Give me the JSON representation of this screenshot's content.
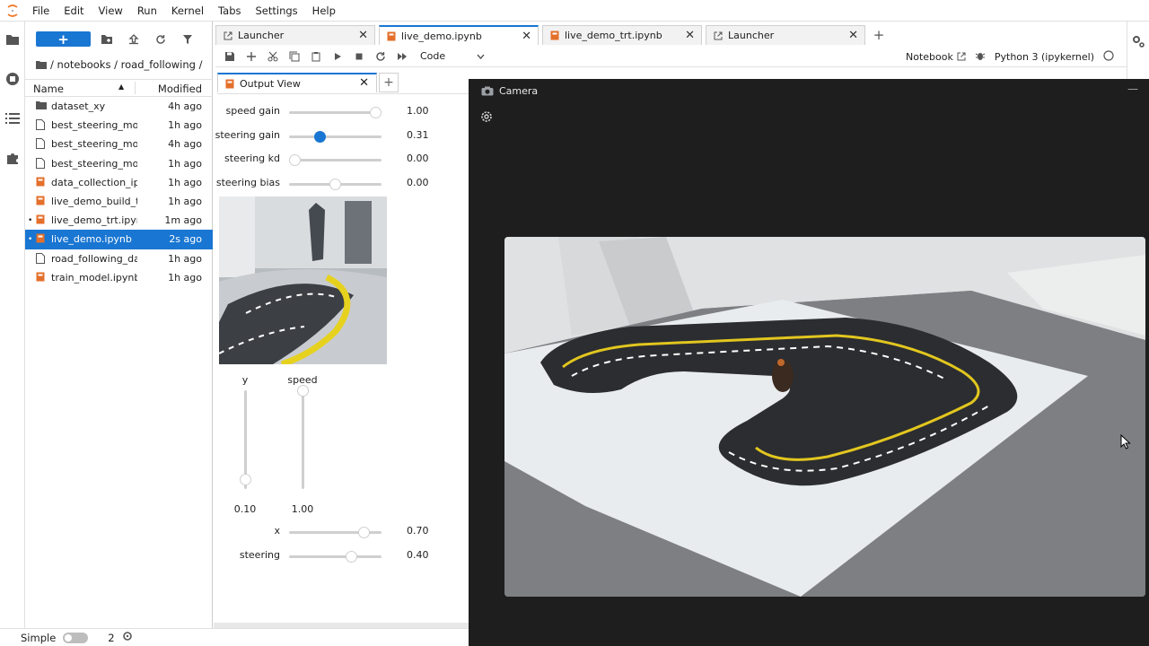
{
  "menu": [
    "File",
    "Edit",
    "View",
    "Run",
    "Kernel",
    "Tabs",
    "Settings",
    "Help"
  ],
  "filebrowser": {
    "new_label": "+",
    "breadcrumb": "/ notebooks / road_following /",
    "col_name": "Name",
    "col_modified": "Modified",
    "files": [
      {
        "name": "dataset_xy",
        "modified": "4h ago",
        "kind": "folder",
        "running": false,
        "selected": false
      },
      {
        "name": "best_steering_mo...",
        "modified": "1h ago",
        "kind": "file",
        "running": false,
        "selected": false
      },
      {
        "name": "best_steering_mo...",
        "modified": "4h ago",
        "kind": "file",
        "running": false,
        "selected": false
      },
      {
        "name": "best_steering_mo...",
        "modified": "1h ago",
        "kind": "file",
        "running": false,
        "selected": false
      },
      {
        "name": "data_collection_ip...",
        "modified": "1h ago",
        "kind": "notebook",
        "running": false,
        "selected": false
      },
      {
        "name": "live_demo_build_t...",
        "modified": "1h ago",
        "kind": "notebook",
        "running": false,
        "selected": false
      },
      {
        "name": "live_demo_trt.ipynb",
        "modified": "1m ago",
        "kind": "notebook",
        "running": true,
        "selected": false
      },
      {
        "name": "live_demo.ipynb",
        "modified": "2s ago",
        "kind": "notebook",
        "running": true,
        "selected": true
      },
      {
        "name": "road_following_da...",
        "modified": "1h ago",
        "kind": "file",
        "running": false,
        "selected": false
      },
      {
        "name": "train_model.ipynb",
        "modified": "1h ago",
        "kind": "notebook",
        "running": false,
        "selected": false
      }
    ]
  },
  "tabs": [
    {
      "label": "Launcher",
      "icon": "launcher-icon",
      "active": false
    },
    {
      "label": "live_demo.ipynb",
      "icon": "notebook-icon",
      "active": true
    },
    {
      "label": "live_demo_trt.ipynb",
      "icon": "notebook-icon",
      "active": false
    },
    {
      "label": "Launcher",
      "icon": "launcher-icon",
      "active": false
    }
  ],
  "toolbar": {
    "cell_type": "Code",
    "notebook_label": "Notebook",
    "kernel_name": "Python 3 (ipykernel)"
  },
  "output_view": {
    "tab_label": "Output View",
    "sliders": [
      {
        "label": "speed gain",
        "value": "1.00",
        "fraction": 1.0,
        "active": false
      },
      {
        "label": "steering gain",
        "value": "0.31",
        "fraction": 0.31,
        "active": true
      },
      {
        "label": "steering kd",
        "value": "0.00",
        "fraction": 0.0,
        "active": false
      },
      {
        "label": "steering bias",
        "value": "0.00",
        "fraction": 0.5,
        "active": false
      }
    ],
    "vsliders": [
      {
        "label": "y",
        "value": "0.10",
        "fraction": 0.1
      },
      {
        "label": "speed",
        "value": "1.00",
        "fraction": 1.0
      }
    ],
    "bottom_sliders": [
      {
        "label": "x",
        "value": "0.70",
        "fraction": 0.85
      },
      {
        "label": "steering",
        "value": "0.40",
        "fraction": 0.7
      }
    ]
  },
  "statusbar": {
    "mode_label": "Simple",
    "kernel_count": "2"
  },
  "camera": {
    "title": "Camera"
  },
  "colors": {
    "accent": "#1976d2",
    "notebook_orange": "#e46f2b",
    "camera_bg": "#1e1e1e"
  }
}
